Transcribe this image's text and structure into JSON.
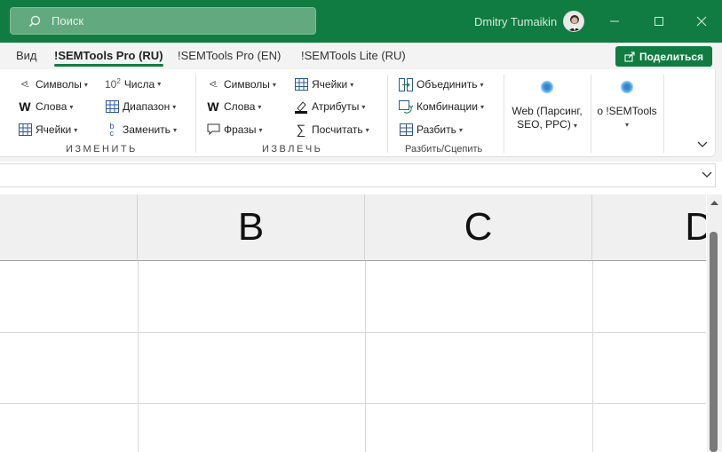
{
  "titlebar": {
    "search_placeholder": "Поиск",
    "user_name": "Dmitry Tumaikin"
  },
  "tabs": [
    {
      "label": "Вид",
      "active": false
    },
    {
      "label": "!SEMTools Pro (RU)",
      "active": true
    },
    {
      "label": "!SEMTools Pro (EN)",
      "active": false
    },
    {
      "label": "!SEMTools Lite (RU)",
      "active": false
    }
  ],
  "share_label": "Поделиться",
  "ribbon": {
    "izmenit": {
      "simvoly": "Символы",
      "chisla_sup": "10",
      "chisla_exp": "2",
      "chisla": "Числа",
      "slova": "Слова",
      "diapazon": "Диапазон",
      "yacheyki": "Ячейки",
      "zamenit": "Заменить",
      "label": "ИЗМЕНИТЬ"
    },
    "izvlech": {
      "simvoly": "Символы",
      "yacheyki": "Ячейки",
      "slova": "Слова",
      "atributy": "Атрибуты",
      "frazy": "Фразы",
      "poschitat": "Посчитать",
      "label": "ИЗВЛЕЧЬ"
    },
    "razbit": {
      "obedinit": "Объединить",
      "kombinacii": "Комбинации",
      "razbit": "Разбить",
      "label": "Разбить/Сцепить"
    },
    "web": {
      "line1": "Web (Парсинг,",
      "line2": "SEO, PPC)"
    },
    "about": {
      "line1": "о !SEMTools"
    }
  },
  "grid": {
    "columns": [
      "B",
      "C",
      "D"
    ]
  },
  "colors": {
    "accent": "#107c41"
  }
}
